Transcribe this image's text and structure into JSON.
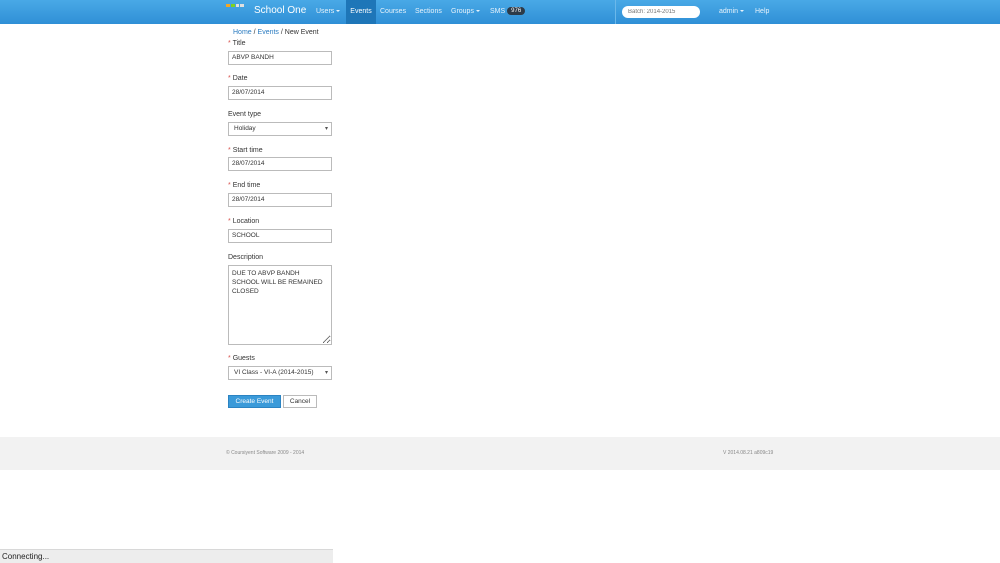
{
  "header": {
    "brand": "School One",
    "logo_colors": [
      "#f5a623",
      "#7ed321",
      "#e0e0e0",
      "#e0e0e0"
    ],
    "nav": {
      "users": "Users",
      "events": "Events",
      "courses": "Courses",
      "sections": "Sections",
      "groups": "Groups",
      "sms": "SMS",
      "sms_count": "976",
      "admin": "admin",
      "help": "Help"
    },
    "batch_placeholder": "Batch: 2014-2015"
  },
  "breadcrumb": {
    "home": "Home",
    "sep1": " / ",
    "events": "Events",
    "sep2": " / ",
    "current": "New Event"
  },
  "form": {
    "required_mark": "*",
    "title": {
      "label": "Title",
      "value": "ABVP BANDH"
    },
    "date": {
      "label": "Date",
      "value": "28/07/2014"
    },
    "event_type": {
      "label": "Event type",
      "value": "Holiday"
    },
    "start_time": {
      "label": "Start time",
      "value": "28/07/2014"
    },
    "end_time": {
      "label": "End time",
      "value": "28/07/2014"
    },
    "location": {
      "label": "Location",
      "value": "SCHOOL"
    },
    "description": {
      "label": "Description",
      "value": "DUE TO ABVP BANDH\nSCHOOL WILL BE REMAINED\nCLOSED"
    },
    "guests": {
      "label": "Guests",
      "value": "VI Class - VI-A (2014-2015)"
    },
    "submit_label": "Create Event",
    "cancel_label": "Cancel"
  },
  "footer": {
    "copyright": "© Coursiyent Software 2009 - 2014",
    "version": "V 2014.08.21 a809c19"
  },
  "status_bar": "Connecting..."
}
